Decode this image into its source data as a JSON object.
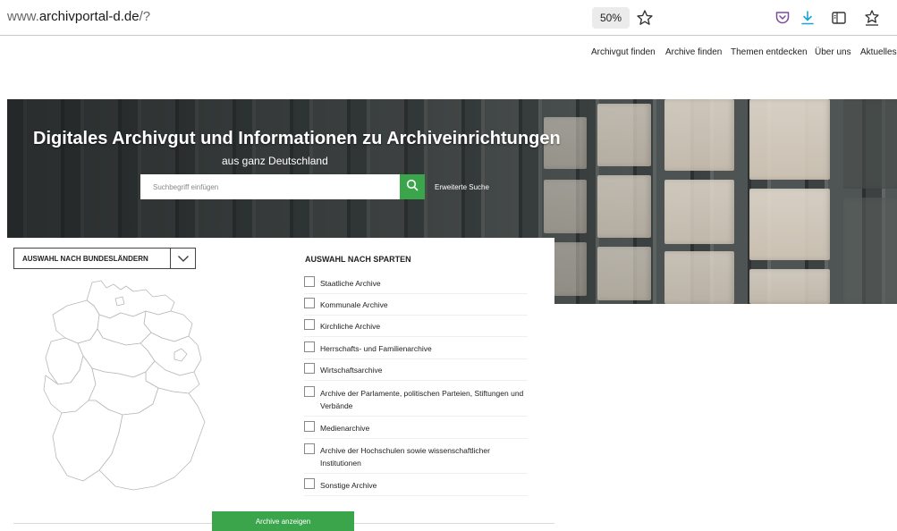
{
  "browser": {
    "url_prefix": "www.",
    "url_domain": "archivportal-d.de",
    "url_path": "/?",
    "zoom": "50%",
    "icons": [
      "star-icon",
      "pocket-icon",
      "download-icon",
      "reader-view-icon",
      "bookmarks-icon"
    ]
  },
  "nav": {
    "items": [
      "Archivgut finden",
      "Archive finden",
      "Themen entdecken",
      "Über uns",
      "Aktuelles"
    ]
  },
  "hero": {
    "title": "Digitales Archivgut und Informationen zu Archiveinrichtungen",
    "subtitle": "aus ganz Deutschland",
    "search_placeholder": "Suchbegriff einfügen",
    "search_icon": "search-icon",
    "advanced_search": "Erweiterte Suche"
  },
  "bundeslaender": {
    "select_label": "AUSWAHL NACH BUNDESLÄNDERN",
    "chevron_icon": "chevron-down-icon"
  },
  "sparten": {
    "title": "AUSWAHL NACH SPARTEN",
    "items": [
      "Staatliche Archive",
      "Kommunale Archive",
      "Kirchliche Archive",
      "Herrschafts- und Familienarchive",
      "Wirtschaftsarchive",
      "Archive der Parlamente, politischen Parteien, Stiftungen und Verbände",
      "Medienarchive",
      "Archive der Hochschulen sowie wissenschaftlicher Institutionen",
      "Sonstige Archive"
    ]
  },
  "actions": {
    "show_archives": "Archive anzeigen"
  },
  "colors": {
    "accent_green": "#3aa54b",
    "download_blue": "#1aa3d6",
    "pocket_purple": "#7a4b9e"
  }
}
